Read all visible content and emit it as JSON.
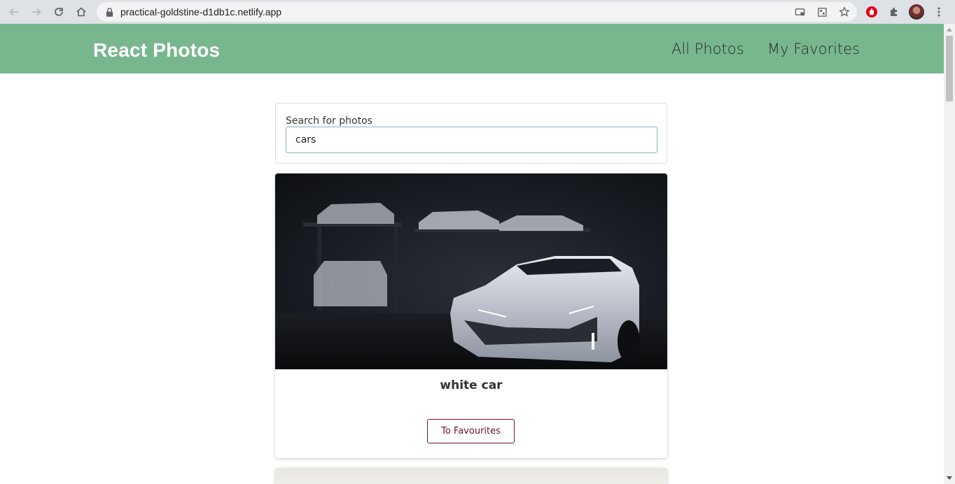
{
  "browser": {
    "url": "practical-goldstine-d1db1c.netlify.app",
    "icons": [
      "back-icon",
      "forward-icon",
      "reload-icon",
      "home-icon",
      "lock-icon",
      "cast-icon",
      "qr-icon",
      "star-icon",
      "extension-red-icon",
      "puzzle-icon",
      "avatar",
      "more-icon"
    ]
  },
  "header": {
    "brand": "React Photos",
    "nav": {
      "all_photos": "All Photos",
      "my_favorites": "My Favorites"
    },
    "color": "#78b78e"
  },
  "search": {
    "label": "Search for photos",
    "value": "cars"
  },
  "photos": [
    {
      "title": "white car",
      "button_label": "To Favourites"
    }
  ],
  "colors": {
    "accent": "#78b78e",
    "button_border": "#6b1230",
    "input_border": "#7ab8c8"
  }
}
